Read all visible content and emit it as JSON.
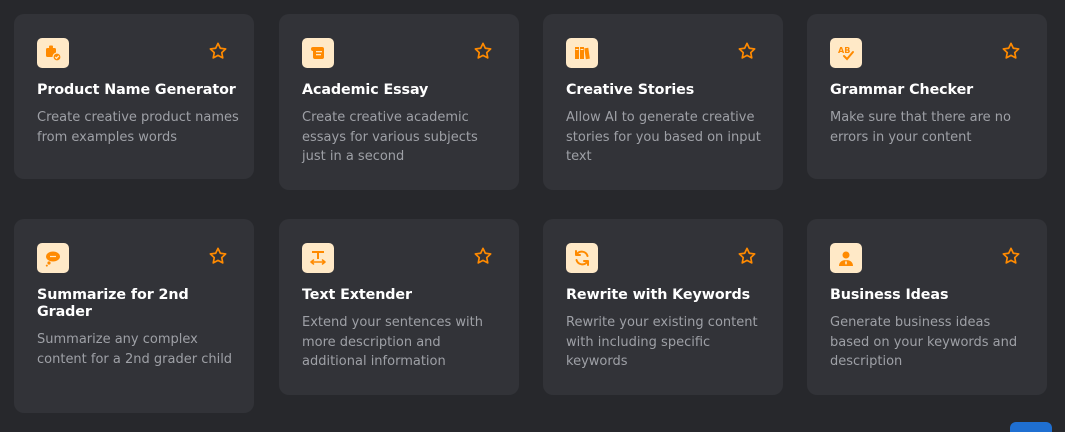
{
  "accent_color": "#ff8a00",
  "tools": [
    {
      "icon": "product-box-icon",
      "title": "Product Name Generator",
      "description": "Create creative product names from examples words"
    },
    {
      "icon": "scroll-icon",
      "title": "Academic Essay",
      "description": "Create creative academic essays for various subjects just in a second"
    },
    {
      "icon": "books-icon",
      "title": "Creative Stories",
      "description": "Allow AI to generate creative stories for you based on input text"
    },
    {
      "icon": "spell-check-icon",
      "title": "Grammar Checker",
      "description": "Make sure that there are no errors in your content"
    },
    {
      "icon": "thought-bubble-icon",
      "title": "Summarize for 2nd Grader",
      "description": "Summarize any complex content for a 2nd grader child"
    },
    {
      "icon": "text-expand-icon",
      "title": "Text Extender",
      "description": "Extend your sentences with more description and additional information"
    },
    {
      "icon": "refresh-icon",
      "title": "Rewrite with Keywords",
      "description": "Rewrite your existing content with including specific keywords"
    },
    {
      "icon": "businessman-icon",
      "title": "Business Ideas",
      "description": "Generate business ideas based on your keywords and description"
    }
  ]
}
